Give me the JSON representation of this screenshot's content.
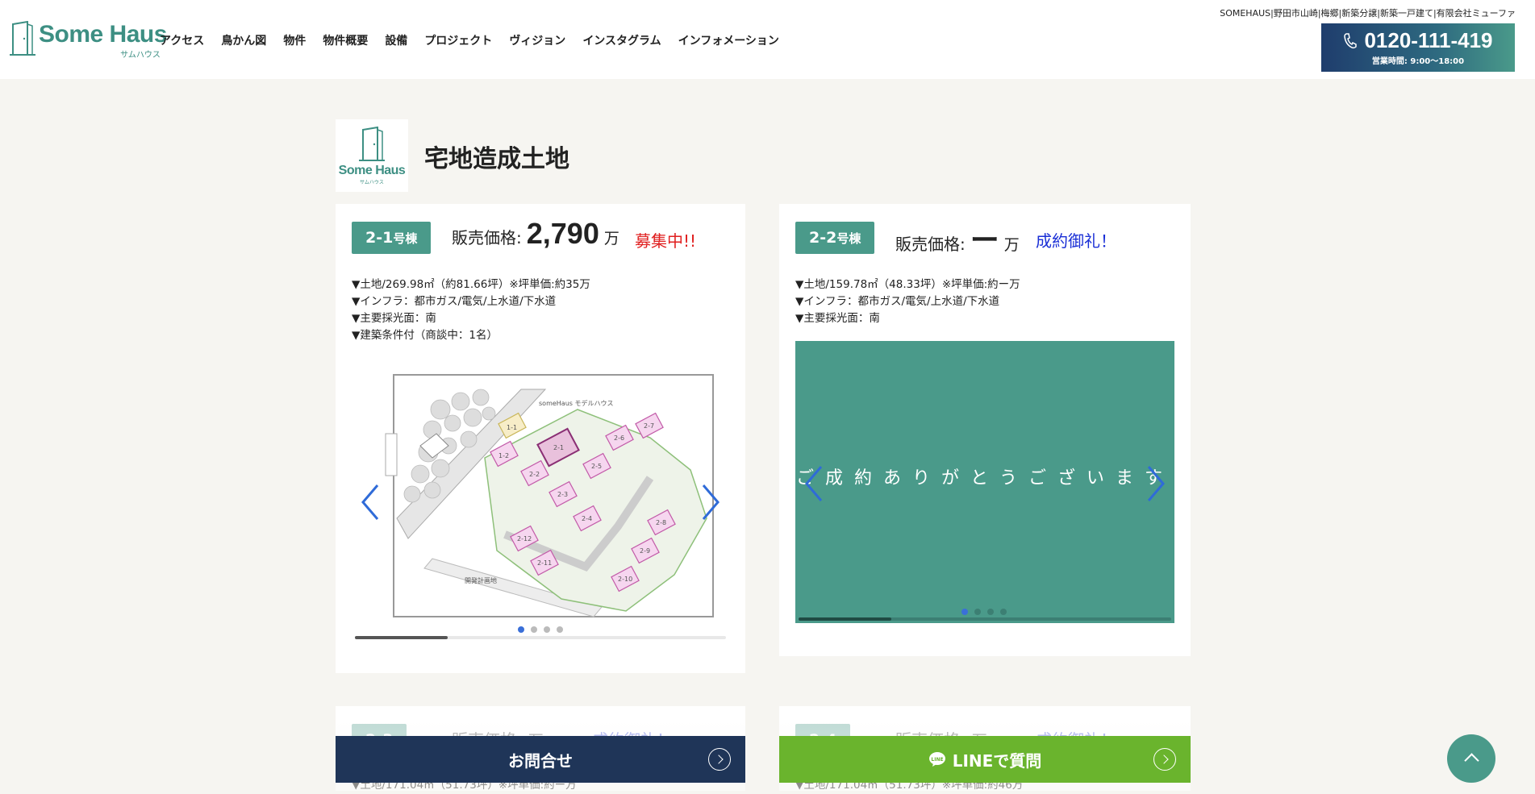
{
  "header": {
    "logo_text": "Some Haus",
    "logo_sub": "サムハウス",
    "nav": [
      "アクセス",
      "鳥かん図",
      "物件",
      "物件概要",
      "設備",
      "プロジェクト",
      "ヴィジョン",
      "インスタグラム",
      "インフォメーション"
    ],
    "top_info": "SOMEHAUS|野田市山崎|梅郷|新築分譲|新築一戸建て|有限会社ミューファ",
    "phone": "0120-111-419",
    "hours": "営業時間: 9:00〜18:00"
  },
  "section": {
    "logo_text": "Some Haus",
    "logo_sub": "サムハウス",
    "title": "宅地造成土地"
  },
  "cards": [
    {
      "badge_main": "2-1",
      "badge_suffix": "号棟",
      "price_label": "販売価格:",
      "price_value": "2,790",
      "price_unit": "万",
      "status": "募集中!!",
      "status_color": "#e02020",
      "details": [
        "▼土地/269.98㎡（約81.66坪）※坪単価:約35万",
        "▼インフラ：都市ガス/電気/上水道/下水道",
        "▼主要採光面：南",
        "▼建築条件付（商談中：1名）"
      ],
      "slider_dots": 4,
      "active_dot": 1
    },
    {
      "badge_main": "2-2",
      "badge_suffix": "号棟",
      "price_label": "販売価格:",
      "price_value": "ー",
      "price_unit": "万",
      "status": "成約御礼！",
      "status_color": "#1a2fd6",
      "details": [
        "▼土地/159.78㎡（48.33坪）※坪単価:約ー万",
        "▼インフラ：都市ガス/電気/上水道/下水道",
        "▼主要採光面：南"
      ],
      "slide_text": "ご成約ありがとうございます",
      "slide_color": "#4a9a8a",
      "slider_dots": 4,
      "active_dot": 1
    }
  ],
  "lower_cards": [
    {
      "badge_main": "2-3",
      "price_label": "販売価格:",
      "price_unit": "万",
      "status": "成約御礼！",
      "detail": "▼土地/171.04㎡（51.73坪）※坪単価:約ー万"
    },
    {
      "badge_main": "2-4",
      "price_label": "販売価格:",
      "price_unit": "万",
      "status": "成約御礼！",
      "detail": "▼土地/171.04㎡（51.73坪）※坪単価:約46万"
    }
  ],
  "map_labels": {
    "model_house": "someHaus モデルハウス",
    "lots": [
      "1-1",
      "1-2",
      "2-1",
      "2-2",
      "2-3",
      "2-4",
      "2-5",
      "2-6",
      "2-7",
      "2-8",
      "2-9",
      "2-10",
      "2-11",
      "2-12"
    ],
    "dev_plan": "開発計画地"
  },
  "cta": {
    "contact_label": "お問合せ",
    "line_label": "LINEで質問",
    "line_icon_text": "LINE",
    "contact_color": "#1f3558",
    "line_color": "#6ab42d"
  }
}
